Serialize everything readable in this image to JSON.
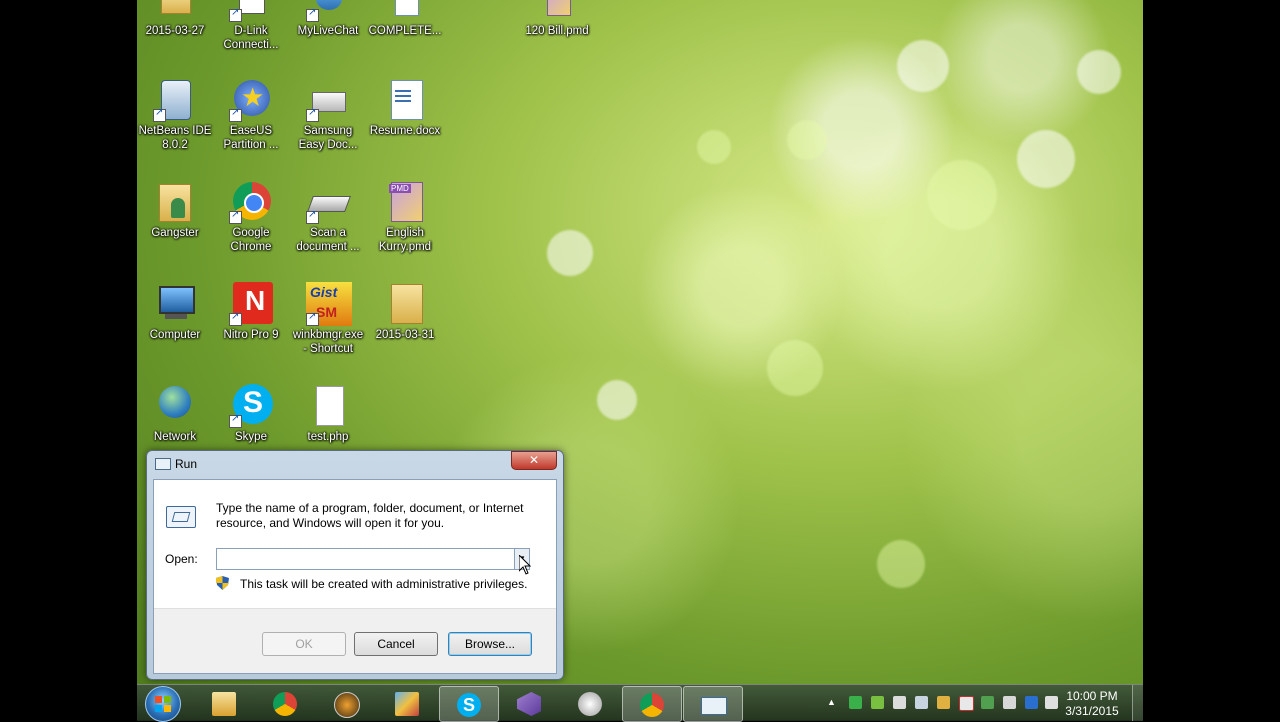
{
  "desktop": {
    "icons": [
      {
        "label": "2015-03-27",
        "type": "folder"
      },
      {
        "label": "D-Link Connecti...",
        "type": "app"
      },
      {
        "label": "MyLiveChat",
        "type": "app"
      },
      {
        "label": "COMPLETE...",
        "type": "doc"
      },
      {
        "label": "120 Bill.pmd",
        "type": "pmd"
      },
      {
        "label": "NetBeans IDE 8.0.2",
        "type": "app"
      },
      {
        "label": "EaseUS Partition ...",
        "type": "app"
      },
      {
        "label": "Samsung Easy Doc...",
        "type": "app"
      },
      {
        "label": "Resume.docx",
        "type": "doc"
      },
      {
        "label": "Gangster",
        "type": "folder"
      },
      {
        "label": "Google Chrome",
        "type": "app"
      },
      {
        "label": "Scan a document ...",
        "type": "app"
      },
      {
        "label": "English Kurry.pmd",
        "type": "pmd"
      },
      {
        "label": "Computer",
        "type": "system"
      },
      {
        "label": "Nitro Pro 9",
        "type": "app"
      },
      {
        "label": "winkbmgr.exe - Shortcut",
        "type": "app"
      },
      {
        "label": "2015-03-31",
        "type": "folder"
      },
      {
        "label": "Network",
        "type": "system"
      },
      {
        "label": "Skype",
        "type": "app"
      },
      {
        "label": "test.php",
        "type": "file"
      }
    ]
  },
  "run_dialog": {
    "title": "Run",
    "description": "Type the name of a program, folder, document, or Internet resource, and Windows will open it for you.",
    "open_label": "Open:",
    "open_value": "",
    "admin_note": "This task will be created with administrative privileges.",
    "ok": "OK",
    "cancel": "Cancel",
    "browse": "Browse...",
    "close_glyph": "✕"
  },
  "taskbar": {
    "buttons": [
      "explorer-icon",
      "chrome-icon",
      "media-icon",
      "paint-icon",
      "skype-icon",
      "visual-studio-icon",
      "snipping-icon",
      "chrome-icon",
      "run-icon"
    ],
    "clock_time": "10:00 PM",
    "clock_date": "3/31/2015",
    "tray_arrow": "▲"
  },
  "colors": {
    "taskbar": "#2e3f2b",
    "desktop_green": "#7aa336",
    "close_red": "#c0392b"
  }
}
